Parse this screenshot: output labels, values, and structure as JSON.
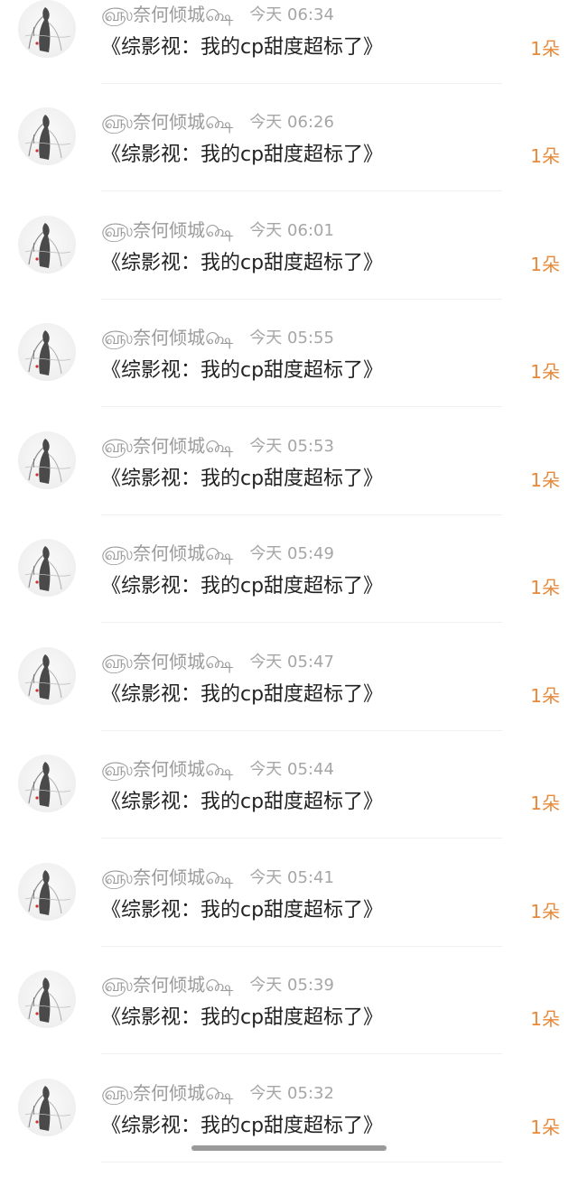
{
  "items": [
    {
      "name": "௵奈何倾城௸",
      "time": "今天 06:34",
      "title": "《综影视：我的cp甜度超标了》",
      "count": "1朵"
    },
    {
      "name": "௵奈何倾城௸",
      "time": "今天 06:26",
      "title": "《综影视：我的cp甜度超标了》",
      "count": "1朵"
    },
    {
      "name": "௵奈何倾城௸",
      "time": "今天 06:01",
      "title": "《综影视：我的cp甜度超标了》",
      "count": "1朵"
    },
    {
      "name": "௵奈何倾城௸",
      "time": "今天 05:55",
      "title": "《综影视：我的cp甜度超标了》",
      "count": "1朵"
    },
    {
      "name": "௵奈何倾城௸",
      "time": "今天 05:53",
      "title": "《综影视：我的cp甜度超标了》",
      "count": "1朵"
    },
    {
      "name": "௵奈何倾城௸",
      "time": "今天 05:49",
      "title": "《综影视：我的cp甜度超标了》",
      "count": "1朵"
    },
    {
      "name": "௵奈何倾城௸",
      "time": "今天 05:47",
      "title": "《综影视：我的cp甜度超标了》",
      "count": "1朵"
    },
    {
      "name": "௵奈何倾城௸",
      "time": "今天 05:44",
      "title": "《综影视：我的cp甜度超标了》",
      "count": "1朵"
    },
    {
      "name": "௵奈何倾城௸",
      "time": "今天 05:41",
      "title": "《综影视：我的cp甜度超标了》",
      "count": "1朵"
    },
    {
      "name": "௵奈何倾城௸",
      "time": "今天 05:39",
      "title": "《综影视：我的cp甜度超标了》",
      "count": "1朵"
    },
    {
      "name": "௵奈何倾城௸",
      "time": "今天 05:32",
      "title": "《综影视：我的cp甜度超标了》",
      "count": "1朵"
    }
  ],
  "icons": {
    "avatar": "ink-painting-figure-avatar"
  },
  "colors": {
    "count": "#e8893a",
    "meta": "#9a9a9a",
    "title": "#222222"
  }
}
